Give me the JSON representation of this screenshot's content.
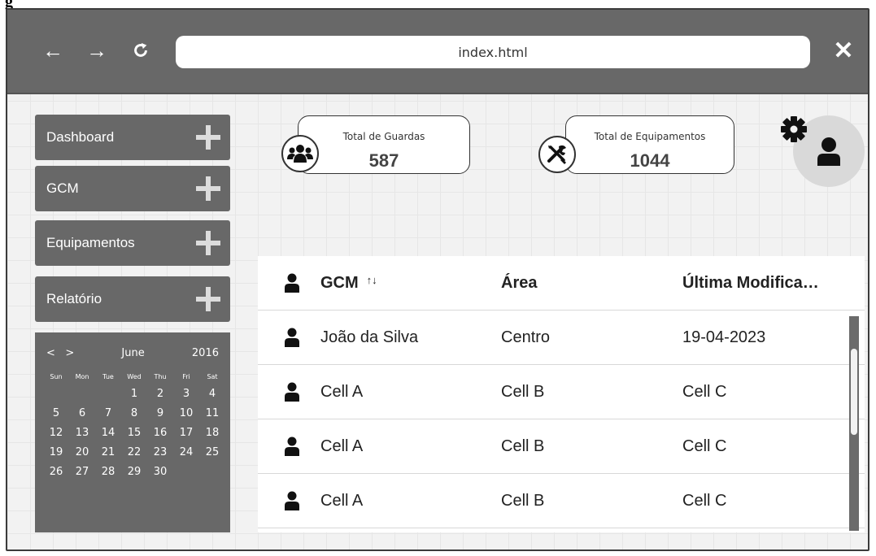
{
  "browser": {
    "url": "index.html",
    "back_icon": "←",
    "forward_icon": "→",
    "reload_icon": "C",
    "close_icon": "✕"
  },
  "sidebar": {
    "items": [
      {
        "label": "Dashboard"
      },
      {
        "label": "GCM"
      },
      {
        "label": "Equipamentos"
      },
      {
        "label": "Relatório"
      }
    ]
  },
  "calendar": {
    "prev": "<",
    "next": ">",
    "month": "June",
    "year": "2016",
    "weekdays": [
      "Sun",
      "Mon",
      "Tue",
      "Wed",
      "Thu",
      "Fri",
      "Sat"
    ],
    "first_weekday_index": 3,
    "days": [
      "1",
      "2",
      "3",
      "4",
      "5",
      "6",
      "7",
      "8",
      "9",
      "10",
      "11",
      "12",
      "13",
      "14",
      "15",
      "16",
      "17",
      "18",
      "19",
      "20",
      "21",
      "22",
      "23",
      "24",
      "25",
      "26",
      "27",
      "28",
      "29",
      "30"
    ]
  },
  "stats": {
    "guards": {
      "label": "Total de Guardas",
      "value": "587",
      "icon": "users-icon"
    },
    "equipment": {
      "label": "Total de Equipamentos",
      "value": "1044",
      "icon": "tools-icon"
    }
  },
  "table": {
    "headers": [
      "GCM",
      "Área",
      "Última Modifica…"
    ],
    "sort_icon": "↑↓",
    "rows": [
      [
        "João da Silva",
        "Centro",
        "19-04-2023"
      ],
      [
        "Cell A",
        "Cell B",
        "Cell C"
      ],
      [
        "Cell A",
        "Cell B",
        "Cell C"
      ],
      [
        "Cell A",
        "Cell B",
        "Cell C"
      ]
    ]
  },
  "colors": {
    "titlebar": "#686868",
    "sidebar": "#686868",
    "background": "#f2f2f2"
  }
}
